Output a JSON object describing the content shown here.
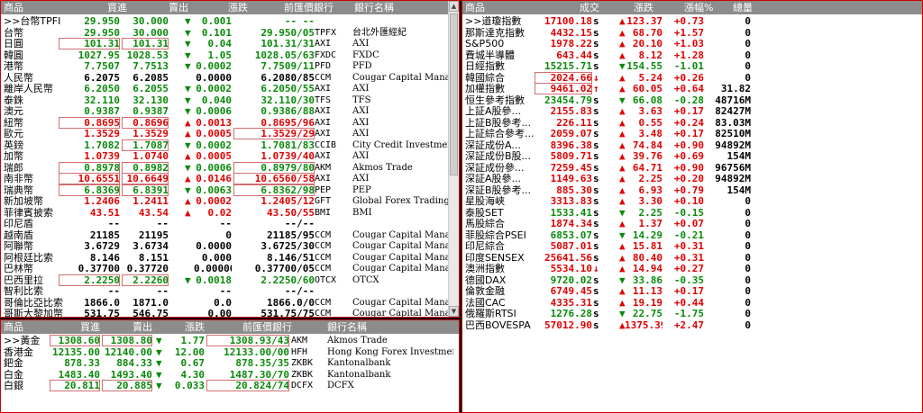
{
  "fx": {
    "headers": {
      "product": "商品",
      "buy": "買進",
      "sell": "賣出",
      "change": "漲跌",
      "close_bank": "前匯價銀行",
      "bank_name": "銀行名稱"
    },
    "rows": [
      {
        "name": ">>台幣TPFI",
        "buy": "29.950",
        "sell": "30.000",
        "arrow": "down",
        "chg": "0.001",
        "prev": "-- --",
        "bank": ""
      },
      {
        "name": "台幣",
        "buy": "29.950",
        "sell": "30.000",
        "arrow": "down",
        "chg": "0.101",
        "prev": "29.950/05",
        "src": "TPFX",
        "bank": "台北外匯經紀"
      },
      {
        "name": "日圓",
        "buy": "101.31",
        "sell": "101.31",
        "arrow": "down",
        "chg": "0.04",
        "prev": "101.31/31",
        "src": "AXI",
        "bank": "AXI",
        "boxbuy": true,
        "boxsell": true
      },
      {
        "name": "韓圓",
        "buy": "1027.95",
        "sell": "1028.53",
        "arrow": "down",
        "chg": "1.05",
        "prev": "1028.05/63",
        "src": "FXDC",
        "bank": "FXDC"
      },
      {
        "name": "港幣",
        "buy": "7.7507",
        "sell": "7.7513",
        "arrow": "down",
        "chg": "0.0002",
        "prev": "7.7509/11",
        "src": "PFD",
        "bank": "PFD"
      },
      {
        "name": "人民幣",
        "buy": "6.2075",
        "sell": "6.2085",
        "arrow": "none",
        "chg": "0.0000",
        "prev": "6.2080/85",
        "src": "CCM",
        "bank": "Cougar Capital Manage..."
      },
      {
        "name": "離岸人民幣",
        "buy": "6.2050",
        "sell": "6.2055",
        "arrow": "down",
        "chg": "0.0002",
        "prev": "6.2050/55",
        "src": "AXI",
        "bank": "AXI"
      },
      {
        "name": "泰銖",
        "buy": "32.110",
        "sell": "32.130",
        "arrow": "down",
        "chg": "0.040",
        "prev": "32.110/30",
        "src": "TFS",
        "bank": "TFS"
      },
      {
        "name": "澳元",
        "buy": "0.9387",
        "sell": "0.9387",
        "arrow": "down",
        "chg": "0.0006",
        "prev": "0.9386/88",
        "src": "AXI",
        "bank": "AXI"
      },
      {
        "name": "紐幣",
        "buy": "0.8695",
        "sell": "0.8696",
        "arrow": "up",
        "chg": "0.0013",
        "prev": "0.8695/96",
        "src": "AXI",
        "bank": "AXI",
        "boxbuy": true,
        "boxsell": true
      },
      {
        "name": "歐元",
        "buy": "1.3529",
        "sell": "1.3529",
        "arrow": "up",
        "chg": "0.0005",
        "prev": "1.3529/29",
        "src": "AXI",
        "bank": "AXI",
        "boxprev": true
      },
      {
        "name": "英鎊",
        "buy": "1.7082",
        "sell": "1.7087",
        "arrow": "down",
        "chg": "0.0002",
        "prev": "1.7081/83",
        "src": "CCIB",
        "bank": "City Credit Investment B...",
        "boxsell": true
      },
      {
        "name": "加幣",
        "buy": "1.0739",
        "sell": "1.0740",
        "arrow": "up",
        "chg": "0.0005",
        "prev": "1.0739/40",
        "src": "AXI",
        "bank": "AXI"
      },
      {
        "name": "瑞郎",
        "buy": "0.8978",
        "sell": "0.8982",
        "arrow": "down",
        "chg": "0.0006",
        "prev": "0.8979/80",
        "src": "AKM",
        "bank": "Akmos Trade",
        "boxbuy": true,
        "boxsell": true,
        "boxprev": true
      },
      {
        "name": "南非幣",
        "buy": "10.6551",
        "sell": "10.6649",
        "arrow": "up",
        "chg": "0.0146",
        "prev": "10.6560/58",
        "src": "AXI",
        "bank": "AXI",
        "boxbuy": true,
        "boxsell": true,
        "boxprev": true
      },
      {
        "name": "瑞典幣",
        "buy": "6.8369",
        "sell": "6.8391",
        "arrow": "down",
        "chg": "0.0063",
        "prev": "6.8362/98",
        "src": "PEP",
        "bank": "PEP",
        "boxbuy": true,
        "boxsell": true,
        "boxprev": true
      },
      {
        "name": "新加坡幣",
        "buy": "1.2406",
        "sell": "1.2411",
        "arrow": "up",
        "chg": "0.0002",
        "prev": "1.2405/12",
        "src": "GFT",
        "bank": "Global Forex Trading"
      },
      {
        "name": "菲律賓披索",
        "buy": "43.51",
        "sell": "43.54",
        "arrow": "up",
        "chg": "0.02",
        "prev": "43.50/55",
        "src": "BMI",
        "bank": "BMI"
      },
      {
        "name": "印尼盾",
        "buy": "--",
        "sell": "--",
        "arrow": "none",
        "chg": "--",
        "prev": "--/--",
        "src": "",
        "bank": "",
        "plain": true
      },
      {
        "name": "越南盾",
        "buy": "21185",
        "sell": "21195",
        "arrow": "none",
        "chg": "0",
        "prev": "21185/95",
        "src": "CCM",
        "bank": "Cougar Capital Manage..."
      },
      {
        "name": "阿聯幣",
        "buy": "3.6729",
        "sell": "3.6734",
        "arrow": "none",
        "chg": "0.0000",
        "prev": "3.6725/30",
        "src": "CCM",
        "bank": "Cougar Capital Manage..."
      },
      {
        "name": "阿根廷比索",
        "buy": "8.146",
        "sell": "8.151",
        "arrow": "none",
        "chg": "0.000",
        "prev": "8.146/51",
        "src": "CCM",
        "bank": "Cougar Capital Manage..."
      },
      {
        "name": "巴林幣",
        "buy": "0.37700",
        "sell": "0.37720",
        "arrow": "none",
        "chg": "0.00000",
        "prev": "0.37700/05",
        "src": "CCM",
        "bank": "Cougar Capital Manage..."
      },
      {
        "name": "巴西里拉",
        "buy": "2.2250",
        "sell": "2.2260",
        "arrow": "down",
        "chg": "0.0018",
        "prev": "2.2250/60",
        "src": "OTCX",
        "bank": "OTCX",
        "boxbuy": true,
        "boxsell": true
      },
      {
        "name": "智利比索",
        "buy": "--",
        "sell": "--",
        "arrow": "none",
        "chg": "--",
        "prev": "--/--",
        "src": "",
        "bank": "",
        "plain": true
      },
      {
        "name": "哥倫比亞比索",
        "buy": "1866.0",
        "sell": "1871.0",
        "arrow": "none",
        "chg": "0.0",
        "prev": "1866.0/0",
        "src": "CCM",
        "bank": "Cougar Capital Manage..."
      },
      {
        "name": "哥斯大黎加幣",
        "buy": "531.75",
        "sell": "546.75",
        "arrow": "none",
        "chg": "0.00",
        "prev": "531.75/75",
        "src": "CCM",
        "bank": "Cougar Capital Manage..."
      }
    ]
  },
  "metal": {
    "headers": {
      "product": "商品",
      "buy": "買進",
      "sell": "賣出",
      "change": "漲跌",
      "close_bank": "前匯價銀行",
      "bank_name": "銀行名稱"
    },
    "rows": [
      {
        "name": ">>黃金",
        "buy": "1308.60",
        "sell": "1308.80",
        "arrow": "down",
        "chg": "1.77",
        "prev": "1308.93/43",
        "src": "AKM",
        "bank": "Akmos Trade",
        "boxbuy": true,
        "boxsell": true,
        "boxprev": true
      },
      {
        "name": "香港金",
        "buy": "12135.00",
        "sell": "12140.00",
        "arrow": "down",
        "chg": "12.00",
        "prev": "12133.00/00",
        "src": "HFH",
        "bank": "Hong Kong Forex Investment"
      },
      {
        "name": "鈀金",
        "buy": "878.33",
        "sell": "884.33",
        "arrow": "down",
        "chg": "0.67",
        "prev": "878.35/35",
        "src": "ZKBK",
        "bank": "Kantonalbank"
      },
      {
        "name": "白金",
        "buy": "1483.40",
        "sell": "1493.40",
        "arrow": "down",
        "chg": "4.30",
        "prev": "1487.30/70",
        "src": "ZKBK",
        "bank": "Kantonalbank"
      },
      {
        "name": "白銀",
        "buy": "20.811",
        "sell": "20.885",
        "arrow": "down",
        "chg": "0.033",
        "prev": "20.824/74",
        "src": "DCFX",
        "bank": "DCFX",
        "boxbuy": true,
        "boxsell": true,
        "boxprev": true
      }
    ]
  },
  "idx": {
    "headers": {
      "product": "商品",
      "price": "成交",
      "change": "漲跌",
      "pct": "漲幅%",
      "volume": "總量"
    },
    "rows": [
      {
        "name": ">>道瓊指數",
        "price": "17100.18",
        "s": "s",
        "arrow": "up",
        "chg": "123.37",
        "pct": "+0.73",
        "vol": "0"
      },
      {
        "name": "那斯達克指數",
        "price": "4432.15",
        "s": "s",
        "arrow": "up",
        "chg": "68.70",
        "pct": "+1.57",
        "vol": "0"
      },
      {
        "name": "S&P500",
        "price": "1978.22",
        "s": "s",
        "arrow": "up",
        "chg": "20.10",
        "pct": "+1.03",
        "vol": "0"
      },
      {
        "name": "費城半導體",
        "price": "643.44",
        "s": "s",
        "arrow": "up",
        "chg": "8.12",
        "pct": "+1.28",
        "vol": "0"
      },
      {
        "name": "日經指數",
        "price": "15215.71",
        "s": "s",
        "arrow": "down",
        "chg": "154.55",
        "pct": "-1.01",
        "vol": "0"
      },
      {
        "name": "韓國綜合",
        "price": "2024.66",
        "s": "↓",
        "arrow": "up",
        "chg": "5.24",
        "pct": "+0.26",
        "vol": "0",
        "boxprice": true
      },
      {
        "name": "加權指數",
        "price": "9461.02",
        "s": "↑",
        "arrow": "up",
        "chg": "60.05",
        "pct": "+0.64",
        "vol": "31.82",
        "boxprice": true
      },
      {
        "name": "恒生參考指數",
        "price": "23454.79",
        "s": "s",
        "arrow": "down",
        "chg": "66.08",
        "pct": "-0.28",
        "vol": "48716M"
      },
      {
        "name": "上証A股參...",
        "price": "2155.83",
        "s": "s",
        "arrow": "up",
        "chg": "3.63",
        "pct": "+0.17",
        "vol": "82427M"
      },
      {
        "name": "上証B股參考...",
        "price": "226.11",
        "s": "s",
        "arrow": "up",
        "chg": "0.55",
        "pct": "+0.24",
        "vol": "83.03M"
      },
      {
        "name": "上証綜合參考...",
        "price": "2059.07",
        "s": "s",
        "arrow": "up",
        "chg": "3.48",
        "pct": "+0.17",
        "vol": "82510M"
      },
      {
        "name": "深証成份A...",
        "price": "8396.38",
        "s": "s",
        "arrow": "up",
        "chg": "74.84",
        "pct": "+0.90",
        "vol": "94892M"
      },
      {
        "name": "深証成份B股...",
        "price": "5809.71",
        "s": "s",
        "arrow": "up",
        "chg": "39.76",
        "pct": "+0.69",
        "vol": "154M"
      },
      {
        "name": "深証成份參...",
        "price": "7259.45",
        "s": "s",
        "arrow": "up",
        "chg": "64.71",
        "pct": "+0.90",
        "vol": "96756M"
      },
      {
        "name": "深証A股參...",
        "price": "1149.63",
        "s": "s",
        "arrow": "up",
        "chg": "2.25",
        "pct": "+0.20",
        "vol": "94892M"
      },
      {
        "name": "深証B股參考...",
        "price": "885.30",
        "s": "s",
        "arrow": "up",
        "chg": "6.93",
        "pct": "+0.79",
        "vol": "154M"
      },
      {
        "name": "星股海峽",
        "price": "3313.83",
        "s": "s",
        "arrow": "up",
        "chg": "3.30",
        "pct": "+0.10",
        "vol": "0"
      },
      {
        "name": "泰股SET",
        "price": "1533.41",
        "s": "s",
        "arrow": "down",
        "chg": "2.25",
        "pct": "-0.15",
        "vol": "0"
      },
      {
        "name": "馬股綜合",
        "price": "1874.34",
        "s": "s",
        "arrow": "up",
        "chg": "1.37",
        "pct": "+0.07",
        "vol": "0"
      },
      {
        "name": "菲股綜合PSEI",
        "price": "6853.07",
        "s": "s",
        "arrow": "down",
        "chg": "14.29",
        "pct": "-0.21",
        "vol": "0"
      },
      {
        "name": "印尼綜合",
        "price": "5087.01",
        "s": "s",
        "arrow": "up",
        "chg": "15.81",
        "pct": "+0.31",
        "vol": "0"
      },
      {
        "name": "印度SENSEX",
        "price": "25641.56",
        "s": "s",
        "arrow": "up",
        "chg": "80.40",
        "pct": "+0.31",
        "vol": "0"
      },
      {
        "name": "澳洲指數",
        "price": "5534.10",
        "s": "↓",
        "arrow": "up",
        "chg": "14.94",
        "pct": "+0.27",
        "vol": "0"
      },
      {
        "name": "德國DAX",
        "price": "9720.02",
        "s": "s",
        "arrow": "down",
        "chg": "33.86",
        "pct": "-0.35",
        "vol": "0"
      },
      {
        "name": "倫敦金融",
        "price": "6749.45",
        "s": "s",
        "arrow": "up",
        "chg": "11.13",
        "pct": "+0.17",
        "vol": "0"
      },
      {
        "name": "法國CAC",
        "price": "4335.31",
        "s": "s",
        "arrow": "up",
        "chg": "19.19",
        "pct": "+0.44",
        "vol": "0"
      },
      {
        "name": "俄羅斯RTSI",
        "price": "1276.28",
        "s": "s",
        "arrow": "down",
        "chg": "22.75",
        "pct": "-1.75",
        "vol": "0"
      },
      {
        "name": "巴西BOVESPA",
        "price": "57012.90",
        "s": "s",
        "arrow": "up",
        "chg": "1375.39",
        "pct": "+2.47",
        "vol": "0"
      }
    ]
  },
  "colors": {
    "up": "#e00000",
    "down": "#0a8a0a",
    "header_bg": "#8c8c8c",
    "border": "#cc0000"
  }
}
